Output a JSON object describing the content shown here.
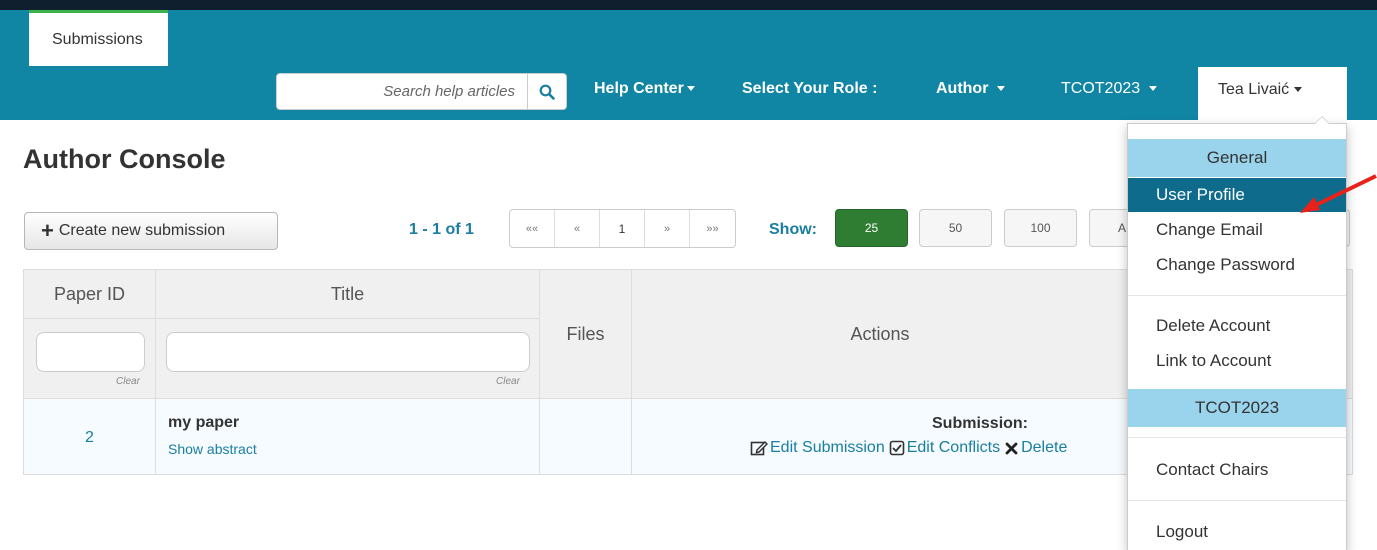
{
  "topbar": {
    "tab_submissions": "Submissions",
    "search_placeholder": "Search help articles",
    "help_center": "Help Center",
    "select_role_label": "Select Your Role :",
    "role": "Author",
    "conference": "TCOT2023",
    "user": "Tea Livaić"
  },
  "main": {
    "title": "Author Console",
    "create_button": "Create new submission",
    "page_range": "1 - 1 of 1",
    "pager": [
      "««",
      "«",
      "1",
      "»",
      "»»"
    ],
    "show_label": "Show:",
    "show_options": [
      "25",
      "50",
      "100",
      "A"
    ],
    "show_selected": "25"
  },
  "table": {
    "headers": {
      "paper_id": "Paper ID",
      "title": "Title",
      "files": "Files",
      "actions": "Actions"
    },
    "clear_label": "Clear",
    "rows": [
      {
        "paper_id": "2",
        "title": "my paper",
        "show_abstract": "Show abstract",
        "submission_label": "Submission:",
        "edit_submission": "Edit Submission",
        "edit_conflicts": "Edit Conflicts",
        "delete": "Delete"
      }
    ]
  },
  "user_menu": {
    "section_general": "General",
    "user_profile": "User Profile",
    "change_email": "Change Email",
    "change_password": "Change Password",
    "delete_account": "Delete Account",
    "link_to_account": "Link to Account",
    "section_conference": "TCOT2023",
    "contact_chairs": "Contact Chairs",
    "logout": "Logout"
  },
  "colors": {
    "topbar": "#1185a4",
    "topbar_edge": "#101f2e",
    "accent_text": "#1a7ea0",
    "show_active": "#2e7d32",
    "menu_header": "#9ad4ec",
    "menu_highlight": "#0e6b8c",
    "annotation_arrow": "#e8221b"
  }
}
